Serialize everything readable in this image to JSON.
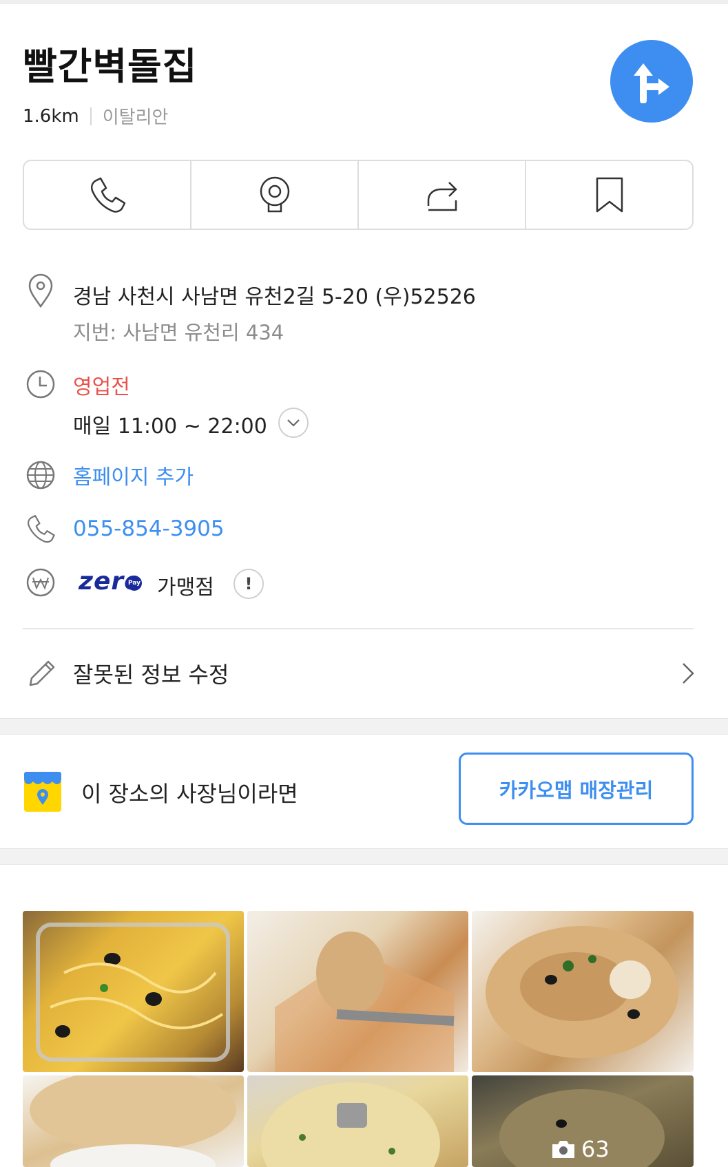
{
  "place": {
    "name": "빨간벽돌집",
    "distance": "1.6km",
    "category": "이탈리안"
  },
  "actions": [
    {
      "icon": "phone-icon"
    },
    {
      "icon": "street-view-icon"
    },
    {
      "icon": "share-icon"
    },
    {
      "icon": "bookmark-icon"
    }
  ],
  "info": {
    "address": "경남 사천시 사남면 유천2길 5-20 (우)52526",
    "address_lot": "지번: 사남면 유천리 434",
    "status": "영업전",
    "hours": "매일 11:00 ~ 22:00",
    "homepage_link": "홈페이지 추가",
    "phone": "055-854-3905",
    "zeropay_logo": "zero",
    "zeropay_badge": "Pay",
    "zeropay_text": "가맹점",
    "zeropay_info_symbol": "!"
  },
  "edit": {
    "label": "잘못된 정보 수정"
  },
  "owner": {
    "text": "이 장소의 사장님이라면",
    "button": "카카오맵 매장관리"
  },
  "photos": {
    "count": "63"
  },
  "colors": {
    "accent": "#3d8ef0",
    "status_closed": "#e9524a",
    "zeropay": "#1a2a9a"
  }
}
